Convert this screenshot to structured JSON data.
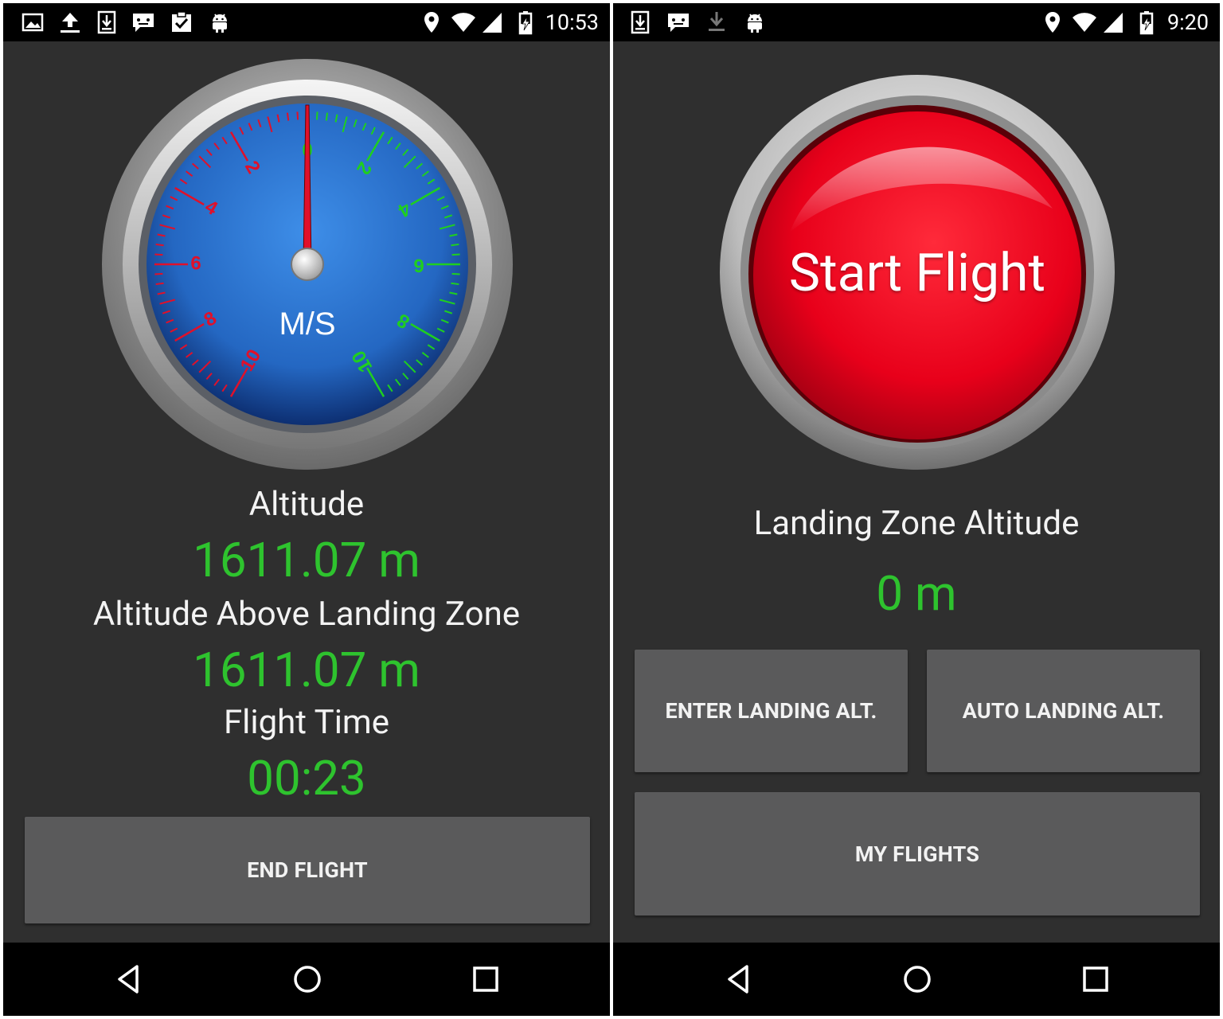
{
  "left": {
    "status_bar": {
      "time": "10:53",
      "icons": [
        "image-icon",
        "upload-icon",
        "download-icon",
        "chat-icon",
        "clipboard-check-icon",
        "android-icon"
      ],
      "right_icons": [
        "location-pin-icon",
        "wifi-icon",
        "signal-icon",
        "battery-charging-icon"
      ]
    },
    "gauge": {
      "unit_label": "M/S",
      "needle_value": 0,
      "left_scale_labels": [
        "2",
        "4",
        "6",
        "8",
        "10"
      ],
      "right_scale_labels": [
        "2",
        "4",
        "6",
        "8",
        "10"
      ],
      "left_scale_color": "#e0102a",
      "right_scale_color": "#1fcf1f",
      "zero_label": "0"
    },
    "altitude_label": "Altitude",
    "altitude_value": "1611.07 m",
    "above_lz_label": "Altitude Above Landing Zone",
    "above_lz_value": "1611.07 m",
    "flight_time_label": "Flight Time",
    "flight_time_value": "00:23",
    "end_flight_button": "END FLIGHT"
  },
  "right": {
    "status_bar": {
      "time": "9:20",
      "icons": [
        "download-icon",
        "chat-icon",
        "download-arrow-icon",
        "android-icon"
      ],
      "right_icons": [
        "location-pin-icon",
        "wifi-icon",
        "signal-icon",
        "battery-charging-icon"
      ]
    },
    "start_flight_button": "Start Flight",
    "landing_zone_label": "Landing Zone Altitude",
    "landing_zone_value": "0 m",
    "enter_landing_button": "ENTER LANDING ALT.",
    "auto_landing_button": "AUTO LANDING ALT.",
    "my_flights_button": "MY FLIGHTS"
  },
  "colors": {
    "background": "#2f2f2f",
    "green_value": "#2ec32e",
    "button_gray": "#5a5a5b",
    "start_red": "#e8001a"
  }
}
